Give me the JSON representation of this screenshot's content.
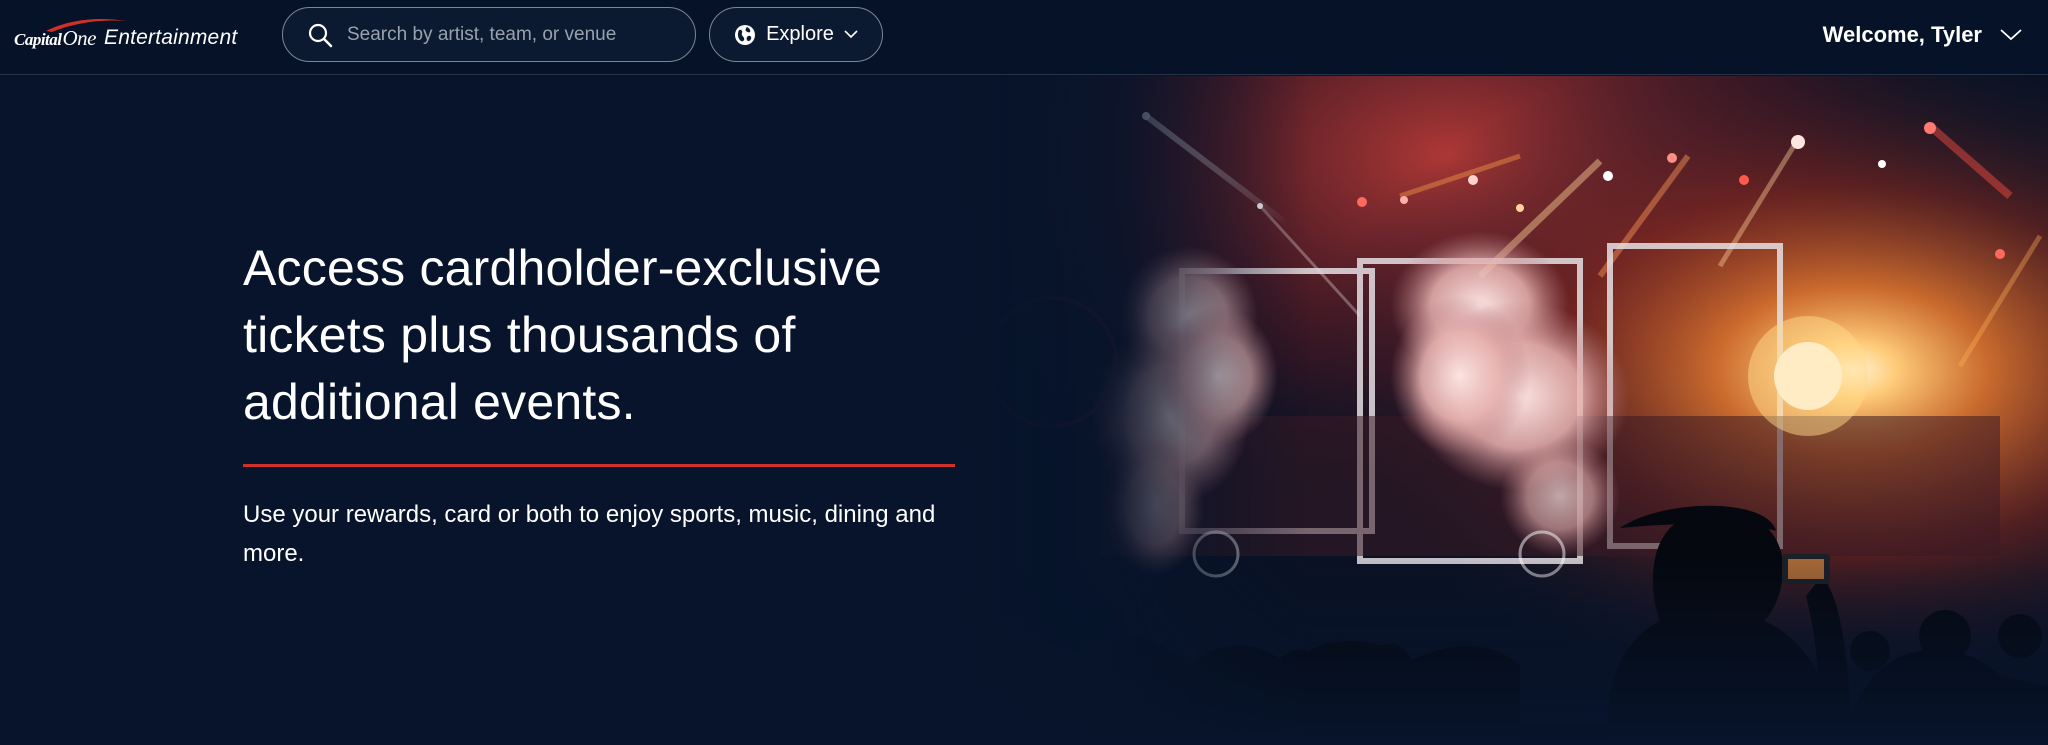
{
  "header": {
    "brand": {
      "logo_capital": "Capital",
      "logo_one": "One",
      "product": "Entertainment"
    },
    "search": {
      "placeholder": "Search by artist, team, or venue",
      "value": "",
      "icon": "search-icon"
    },
    "explore": {
      "label": "Explore",
      "icon": "globe-icon",
      "chevron": "chevron-down-icon"
    },
    "account": {
      "label": "Welcome, Tyler",
      "chevron": "chevron-down-icon"
    }
  },
  "hero": {
    "headline": "Access cardholder-exclusive tickets plus thousands of additional events.",
    "subtext": "Use your rewards, card or both to enjoy sports, music, dining and more.",
    "accent_color": "#d03027",
    "image_subject": "concert stage with red lights and smoke, crowd in foreground"
  },
  "colors": {
    "background": "#07142b",
    "header_bg": "#061227",
    "text": "#ffffff",
    "accent_red": "#d03027"
  }
}
